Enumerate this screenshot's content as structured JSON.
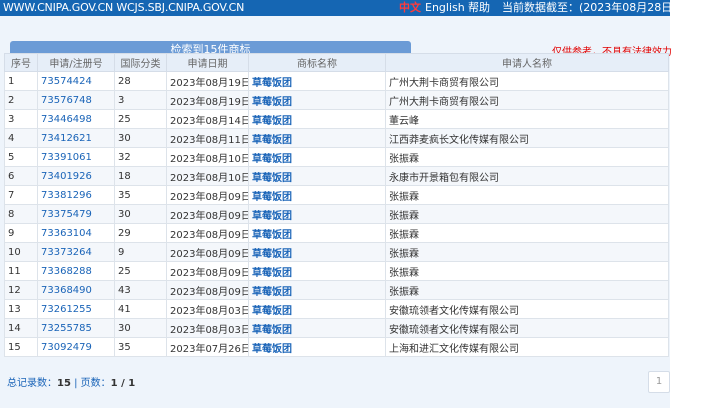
{
  "header": {
    "site_urls": "WWW.CNIPA.GOV.CN WCJS.SBJ.CNIPA.GOV.CN",
    "lang_zh": "中文",
    "lang_en": "English",
    "help": "帮助",
    "data_updated": "当前数据截至：(2023年08月28日)"
  },
  "result_label": "检索到15件商标",
  "disclaimer": "仅供参考，不具有法律效力",
  "table": {
    "columns": [
      "序号",
      "申请/注册号",
      "国际分类",
      "申请日期",
      "商标名称",
      "申请人名称"
    ],
    "rows": [
      {
        "no": "1",
        "reg": "73574424",
        "cls": "28",
        "date": "2023年08月19日",
        "mark": "草莓饭团",
        "applicant": "广州大荆卡商贸有限公司"
      },
      {
        "no": "2",
        "reg": "73576748",
        "cls": "3",
        "date": "2023年08月19日",
        "mark": "草莓饭团",
        "applicant": "广州大荆卡商贸有限公司"
      },
      {
        "no": "3",
        "reg": "73446498",
        "cls": "25",
        "date": "2023年08月14日",
        "mark": "草莓饭团",
        "applicant": "董云峰"
      },
      {
        "no": "4",
        "reg": "73412621",
        "cls": "30",
        "date": "2023年08月11日",
        "mark": "草莓饭团",
        "applicant": "江西莽麦疯长文化传媒有限公司"
      },
      {
        "no": "5",
        "reg": "73391061",
        "cls": "32",
        "date": "2023年08月10日",
        "mark": "草莓饭团",
        "applicant": "张振霖"
      },
      {
        "no": "6",
        "reg": "73401926",
        "cls": "18",
        "date": "2023年08月10日",
        "mark": "草莓饭团",
        "applicant": "永康市开景箱包有限公司"
      },
      {
        "no": "7",
        "reg": "73381296",
        "cls": "35",
        "date": "2023年08月09日",
        "mark": "草莓饭团",
        "applicant": "张振霖"
      },
      {
        "no": "8",
        "reg": "73375479",
        "cls": "30",
        "date": "2023年08月09日",
        "mark": "草莓饭团",
        "applicant": "张振霖"
      },
      {
        "no": "9",
        "reg": "73363104",
        "cls": "29",
        "date": "2023年08月09日",
        "mark": "草莓饭团",
        "applicant": "张振霖"
      },
      {
        "no": "10",
        "reg": "73373264",
        "cls": "9",
        "date": "2023年08月09日",
        "mark": "草莓饭团",
        "applicant": "张振霖"
      },
      {
        "no": "11",
        "reg": "73368288",
        "cls": "25",
        "date": "2023年08月09日",
        "mark": "草莓饭团",
        "applicant": "张振霖"
      },
      {
        "no": "12",
        "reg": "73368490",
        "cls": "43",
        "date": "2023年08月09日",
        "mark": "草莓饭团",
        "applicant": "张振霖"
      },
      {
        "no": "13",
        "reg": "73261255",
        "cls": "41",
        "date": "2023年08月03日",
        "mark": "草莓饭团",
        "applicant": "安徽琉领者文化传媒有限公司"
      },
      {
        "no": "14",
        "reg": "73255785",
        "cls": "30",
        "date": "2023年08月03日",
        "mark": "草莓饭团",
        "applicant": "安徽琉领者文化传媒有限公司"
      },
      {
        "no": "15",
        "reg": "73092479",
        "cls": "35",
        "date": "2023年07月26日",
        "mark": "草莓饭团",
        "applicant": "上海和进汇文化传媒有限公司"
      }
    ]
  },
  "footer": {
    "total_label": "总记录数：",
    "total": "15",
    "sep": " | ",
    "pages_label": "页数：",
    "pages": "1 / 1"
  },
  "pager_page": "1",
  "colors": {
    "header_bg": "#1566b3",
    "link": "#1a64b8",
    "warning": "#e00000",
    "result_bar": "#6b9bd6"
  }
}
